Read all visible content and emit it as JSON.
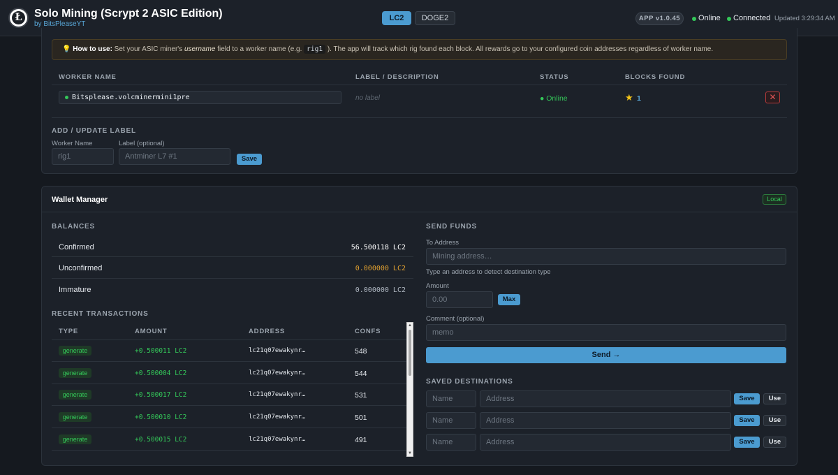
{
  "header": {
    "logo_letter": "Ł",
    "title": "Solo Mining (Scrypt 2 ASIC Edition)",
    "subtitle": "by BitsPleaseYT",
    "coin_tabs": [
      {
        "label": "LC2",
        "active": true
      },
      {
        "label": "DOGE2",
        "active": false
      }
    ],
    "version": "APP v1.0.45",
    "status_online": "Online",
    "status_connected": "Connected",
    "updated": "Updated 3:29:34 AM"
  },
  "workers": {
    "tip_title": "How to use:",
    "tip_text_1": " Set your ASIC miner's ",
    "tip_italic": "username",
    "tip_text_2": " field to a worker name (e.g. ",
    "tip_code": "rig1",
    "tip_text_3": " ). The app will track which rig found each block. All rewards go to your configured coin addresses regardless of worker name.",
    "columns": [
      "WORKER NAME",
      "LABEL / DESCRIPTION",
      "STATUS",
      "BLOCKS FOUND"
    ],
    "rows": [
      {
        "name": "Bitsplease.volcminermini1pre",
        "label": "no label",
        "status": "Online",
        "blocks": "1"
      }
    ],
    "delete_symbol": "✕",
    "form": {
      "title": "ADD / UPDATE LABEL",
      "worker_name_label": "Worker Name",
      "worker_name_placeholder": "rig1",
      "label_label": "Label (optional)",
      "label_placeholder": "Antminer L7 #1",
      "save_label": "Save"
    }
  },
  "wallet": {
    "title": "Wallet Manager",
    "badge": "Local",
    "balances_title": "BALANCES",
    "balances": [
      {
        "label": "Confirmed",
        "value": "56.500118 LC2",
        "color": "#ffffff"
      },
      {
        "label": "Unconfirmed",
        "value": "0.000000 LC2",
        "color": "#e0a030"
      },
      {
        "label": "Immature",
        "value": "0.000000 LC2",
        "color": "#aeb6c0"
      }
    ],
    "tx_title": "RECENT TRANSACTIONS",
    "tx_columns": [
      "TYPE",
      "AMOUNT",
      "ADDRESS",
      "CONFS"
    ],
    "transactions": [
      {
        "type": "generate",
        "amount": "+0.500011 LC2",
        "address": "lc21q07ewakynr…",
        "confs": "548"
      },
      {
        "type": "generate",
        "amount": "+0.500004 LC2",
        "address": "lc21q07ewakynr…",
        "confs": "544"
      },
      {
        "type": "generate",
        "amount": "+0.500017 LC2",
        "address": "lc21q07ewakynr…",
        "confs": "531"
      },
      {
        "type": "generate",
        "amount": "+0.500010 LC2",
        "address": "lc21q07ewakynr…",
        "confs": "501"
      },
      {
        "type": "generate",
        "amount": "+0.500015 LC2",
        "address": "lc21q07ewakynr…",
        "confs": "491"
      }
    ],
    "send": {
      "title": "SEND FUNDS",
      "to_label": "To Address",
      "to_placeholder": "Mining address…",
      "hint": "Type an address to detect destination type",
      "amount_label": "Amount",
      "amount_placeholder": "0.00",
      "max_label": "Max",
      "comment_label": "Comment (optional)",
      "comment_placeholder": "memo",
      "send_label": "Send →"
    },
    "saved": {
      "title": "SAVED DESTINATIONS",
      "name_placeholder": "Name",
      "address_placeholder": "Address",
      "save_label": "Save",
      "use_label": "Use"
    }
  }
}
